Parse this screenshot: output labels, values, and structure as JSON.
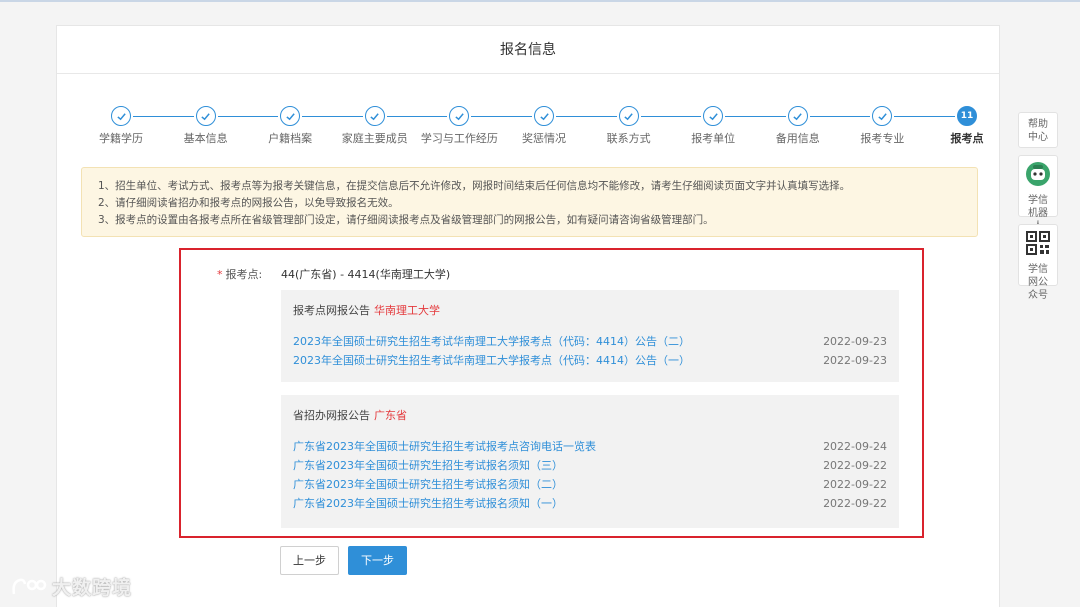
{
  "page": {
    "title": "报名信息"
  },
  "steps": [
    {
      "label": "学籍学历",
      "done": true
    },
    {
      "label": "基本信息",
      "done": true
    },
    {
      "label": "户籍档案",
      "done": true
    },
    {
      "label": "家庭主要成员",
      "done": true
    },
    {
      "label": "学习与工作经历",
      "done": true
    },
    {
      "label": "奖惩情况",
      "done": true
    },
    {
      "label": "联系方式",
      "done": true
    },
    {
      "label": "报考单位",
      "done": true
    },
    {
      "label": "备用信息",
      "done": true
    },
    {
      "label": "报考专业",
      "done": true
    },
    {
      "label": "报考点",
      "number": "11",
      "active": true
    }
  ],
  "notice": [
    "1、招生单位、考试方式、报考点等为报考关键信息，在提交信息后不允许修改，网报时间结束后任何信息均不能修改，请考生仔细阅读页面文字并认真填写选择。",
    "2、请仔细阅读省招办和报考点的网报公告，以免导致报名无效。",
    "3、报考点的设置由各报考点所在省级管理部门设定，请仔细阅读报考点及省级管理部门的网报公告，如有疑问请咨询省级管理部门。"
  ],
  "field": {
    "star": "*",
    "label": "报考点:",
    "value": "44(广东省) - 4414(华南理工大学)"
  },
  "site_panel": {
    "head": "报考点网报公告",
    "org": "华南理工大学",
    "items": [
      {
        "title": "2023年全国硕士研究生招生考试华南理工大学报考点（代码：4414）公告（二）",
        "date": "2022-09-23"
      },
      {
        "title": "2023年全国硕士研究生招生考试华南理工大学报考点（代码：4414）公告（一）",
        "date": "2022-09-23"
      }
    ]
  },
  "province_panel": {
    "head": "省招办网报公告",
    "org": "广东省",
    "items": [
      {
        "title": "广东省2023年全国硕士研究生招生考试报考点咨询电话一览表",
        "date": "2022-09-24"
      },
      {
        "title": "广东省2023年全国硕士研究生招生考试报名须知（三）",
        "date": "2022-09-22"
      },
      {
        "title": "广东省2023年全国硕士研究生招生考试报名须知（二）",
        "date": "2022-09-22"
      },
      {
        "title": "广东省2023年全国硕士研究生招生考试报名须知（一）",
        "date": "2022-09-22"
      }
    ]
  },
  "buttons": {
    "prev": "上一步",
    "next": "下一步"
  },
  "sidebar": {
    "help": "帮助中心",
    "robot": "学信机器人",
    "wechat": "学信网公众号"
  },
  "watermark": "大数跨境",
  "colors": {
    "accent": "#2f8fd8",
    "highlight": "#d9232d",
    "org": "#e4393c",
    "notice_bg": "#fdf6e3"
  },
  "icons": [
    "check-icon",
    "robot-icon",
    "qr-code-icon"
  ]
}
